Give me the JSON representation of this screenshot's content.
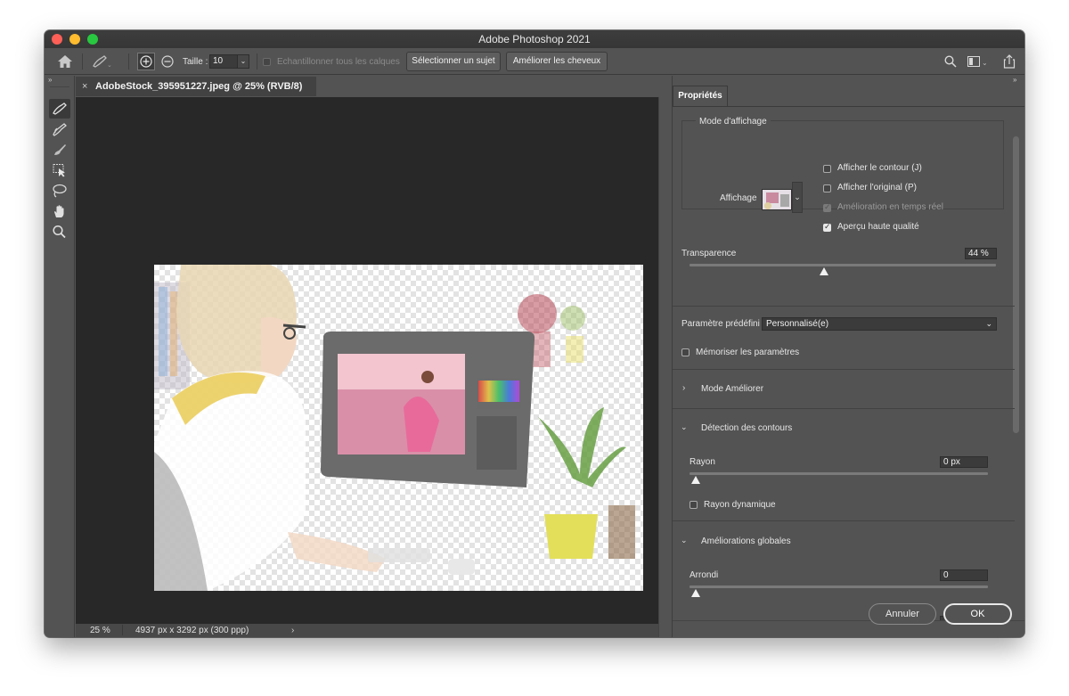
{
  "window": {
    "title": "Adobe Photoshop 2021"
  },
  "options_bar": {
    "size_label": "Taille :",
    "size_value": "10",
    "sample_all_layers_label": "Echantillonner tous les calques",
    "select_subject_button": "Sélectionner un sujet",
    "refine_hair_button": "Améliorer les cheveux"
  },
  "document": {
    "tab_title": "AdobeStock_395951227.jpeg @ 25% (RVB/8)",
    "close_glyph": "×"
  },
  "status_bar": {
    "zoom": "25 %",
    "dimensions": "4937 px x 3292 px (300 ppp)"
  },
  "properties_panel": {
    "tab_label": "Propriétés",
    "view_mode": {
      "legend": "Mode d'affichage",
      "view_label": "Affichage",
      "options": [
        {
          "label": "Afficher le contour (J)",
          "checked": false,
          "disabled": false
        },
        {
          "label": "Afficher l'original (P)",
          "checked": false,
          "disabled": false
        },
        {
          "label": "Amélioration en temps réel",
          "checked": true,
          "disabled": true
        },
        {
          "label": "Aperçu haute qualité",
          "checked": true,
          "disabled": false
        }
      ]
    },
    "transparency": {
      "label": "Transparence",
      "value_text": "44 %",
      "value": 44
    },
    "preset": {
      "label": "Paramètre prédéfini",
      "value": "Personnalisé(e)"
    },
    "remember_settings": {
      "label": "Mémoriser les paramètres",
      "checked": false
    },
    "refine_mode": {
      "title": "Mode Améliorer",
      "expanded": false
    },
    "edge_detection": {
      "title": "Détection des contours",
      "expanded": true,
      "radius_label": "Rayon",
      "radius_value": "0 px",
      "smart_radius_label": "Rayon dynamique",
      "smart_radius_checked": false
    },
    "global_refinements": {
      "title": "Améliorations globales",
      "expanded": true,
      "smooth_label": "Arrondi",
      "smooth_value": "0"
    },
    "cancel_button": "Annuler",
    "ok_button": "OK"
  }
}
